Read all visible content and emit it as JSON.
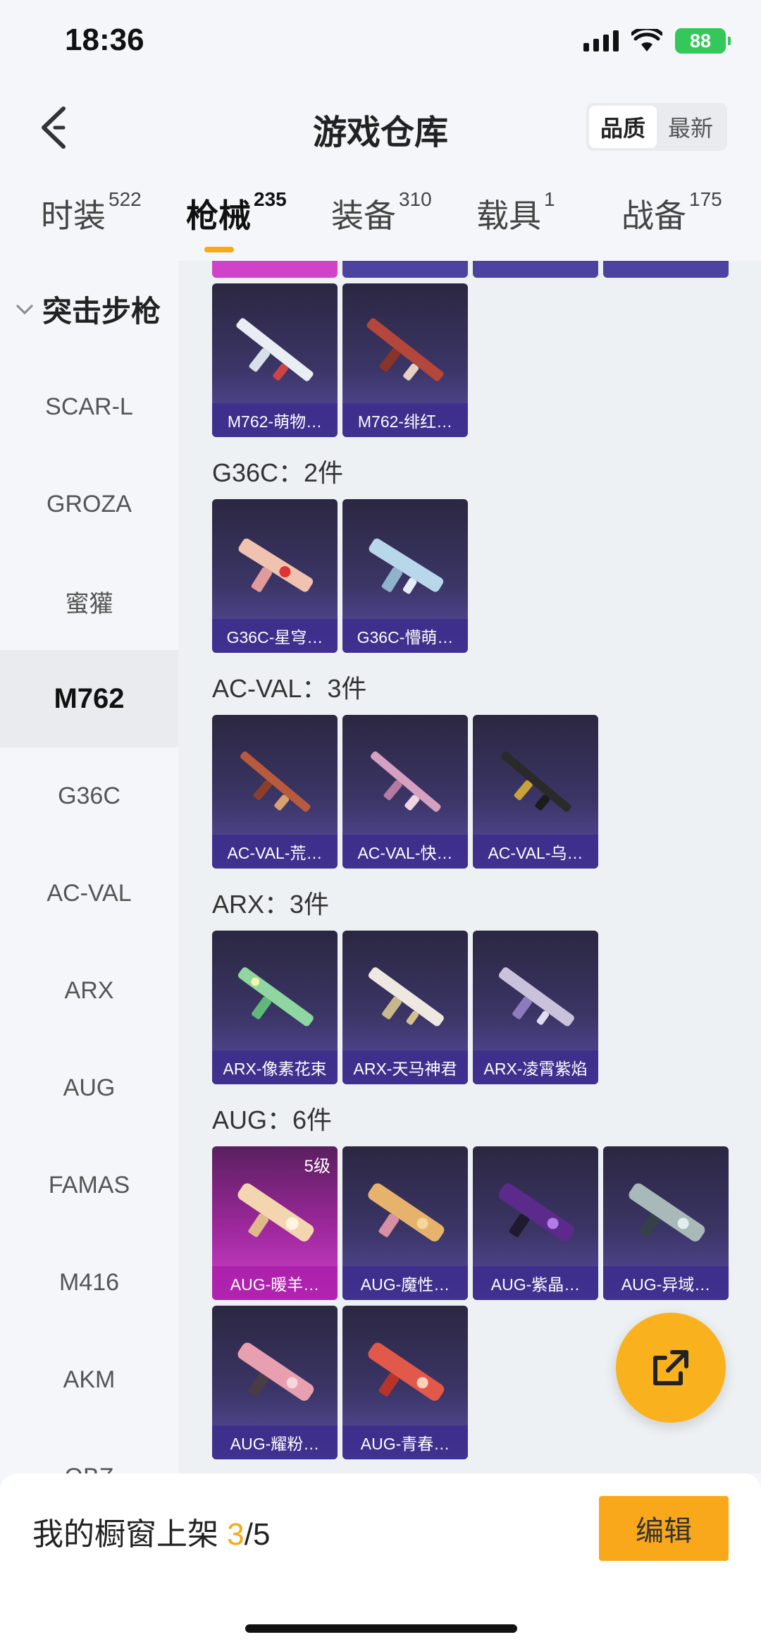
{
  "status": {
    "time": "18:36",
    "battery": "88"
  },
  "header": {
    "title": "游戏仓库",
    "sort_options": [
      "品质",
      "最新"
    ]
  },
  "tabs": [
    {
      "label": "时装",
      "count": "522"
    },
    {
      "label": "枪械",
      "count": "235"
    },
    {
      "label": "装备",
      "count": "310"
    },
    {
      "label": "载具",
      "count": "1"
    },
    {
      "label": "战备",
      "count": "175"
    }
  ],
  "sidebar": {
    "category": "突击步枪",
    "items": [
      "SCAR-L",
      "GROZA",
      "蜜獾",
      "M762",
      "G36C",
      "AC-VAL",
      "ARX",
      "AUG",
      "FAMAS",
      "M416",
      "AKM",
      "QBZ"
    ],
    "selected": "M762"
  },
  "groups": [
    {
      "title": "",
      "cards": [
        "M762-萌物…",
        "M762-绯红…"
      ]
    },
    {
      "title": "G36C：2件",
      "cards": [
        "G36C-星穹…",
        "G36C-懵萌…"
      ]
    },
    {
      "title": "AC-VAL：3件",
      "cards": [
        "AC-VAL-荒…",
        "AC-VAL-快…",
        "AC-VAL-乌…"
      ]
    },
    {
      "title": "ARX：3件",
      "cards": [
        "ARX-像素花束",
        "ARX-天马神君",
        "ARX-凌霄紫焰"
      ]
    },
    {
      "title": "AUG：6件",
      "cards": [
        "AUG-暖羊…",
        "AUG-魔性…",
        "AUG-紫晶…",
        "AUG-异域…",
        "AUG-耀粉…",
        "AUG-青春…"
      ]
    }
  ],
  "badges": {
    "aug_level": "5级"
  },
  "bottom": {
    "text": "我的橱窗上架",
    "current": "3",
    "total": "/5",
    "edit_label": "编辑"
  }
}
